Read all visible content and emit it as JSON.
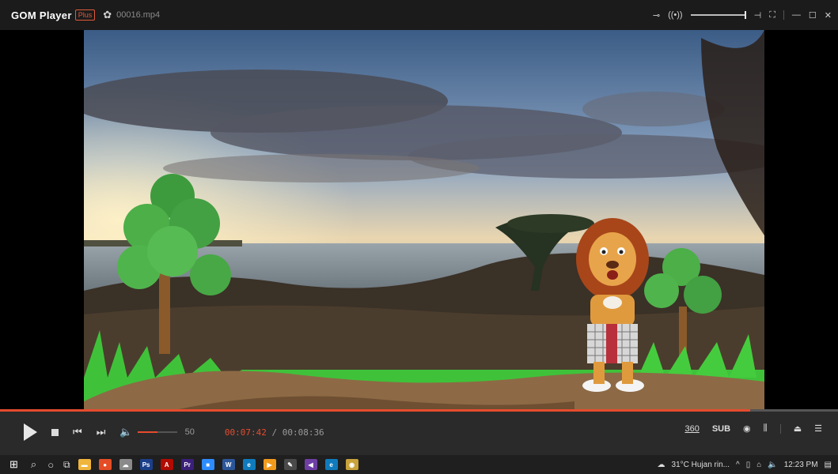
{
  "title_bar": {
    "app_name": "GOM Player",
    "plus_badge": "Plus",
    "filename": "00016.mp4"
  },
  "player": {
    "progress_fraction": 0.895,
    "volume_fraction": 0.5,
    "volume_value": "50",
    "current_time": "00:07:42",
    "time_separator": "/",
    "total_time": "00:08:36",
    "right_controls": {
      "vr360_label": "360",
      "subtitle_label": "SUB"
    }
  },
  "taskbar": {
    "weather": "31°C  Hujan rin...",
    "clock": "12:23 PM",
    "apps": [
      {
        "name": "file-explorer",
        "color": "#f0b53c",
        "glyph": "▬"
      },
      {
        "name": "chrome",
        "color": "#e44d26",
        "glyph": "●"
      },
      {
        "name": "app-cloud",
        "color": "#8a8a8a",
        "glyph": "☁"
      },
      {
        "name": "photoshop",
        "color": "#1c3f8a",
        "glyph": "Ps"
      },
      {
        "name": "acrobat",
        "color": "#b30b00",
        "glyph": "A"
      },
      {
        "name": "premiere",
        "color": "#3b1f7a",
        "glyph": "Pr"
      },
      {
        "name": "zoom",
        "color": "#2d8cff",
        "glyph": "■"
      },
      {
        "name": "word",
        "color": "#2b579a",
        "glyph": "W"
      },
      {
        "name": "edge",
        "color": "#0f7bbd",
        "glyph": "e"
      },
      {
        "name": "app-orange",
        "color": "#f09a1c",
        "glyph": "▶"
      },
      {
        "name": "app-pen",
        "color": "#4a4a4a",
        "glyph": "✎"
      },
      {
        "name": "visual-studio",
        "color": "#6e3fa5",
        "glyph": "◀"
      },
      {
        "name": "edge-2",
        "color": "#0f7bbd",
        "glyph": "e"
      },
      {
        "name": "app-active",
        "color": "#c8a23a",
        "glyph": "◉"
      }
    ]
  },
  "colors": {
    "accent": "#e64b2e",
    "titlebar_bg": "#1b1b1b",
    "controlbar_bg": "#2a2a2a",
    "taskbar_bg": "#1f1f1f"
  }
}
